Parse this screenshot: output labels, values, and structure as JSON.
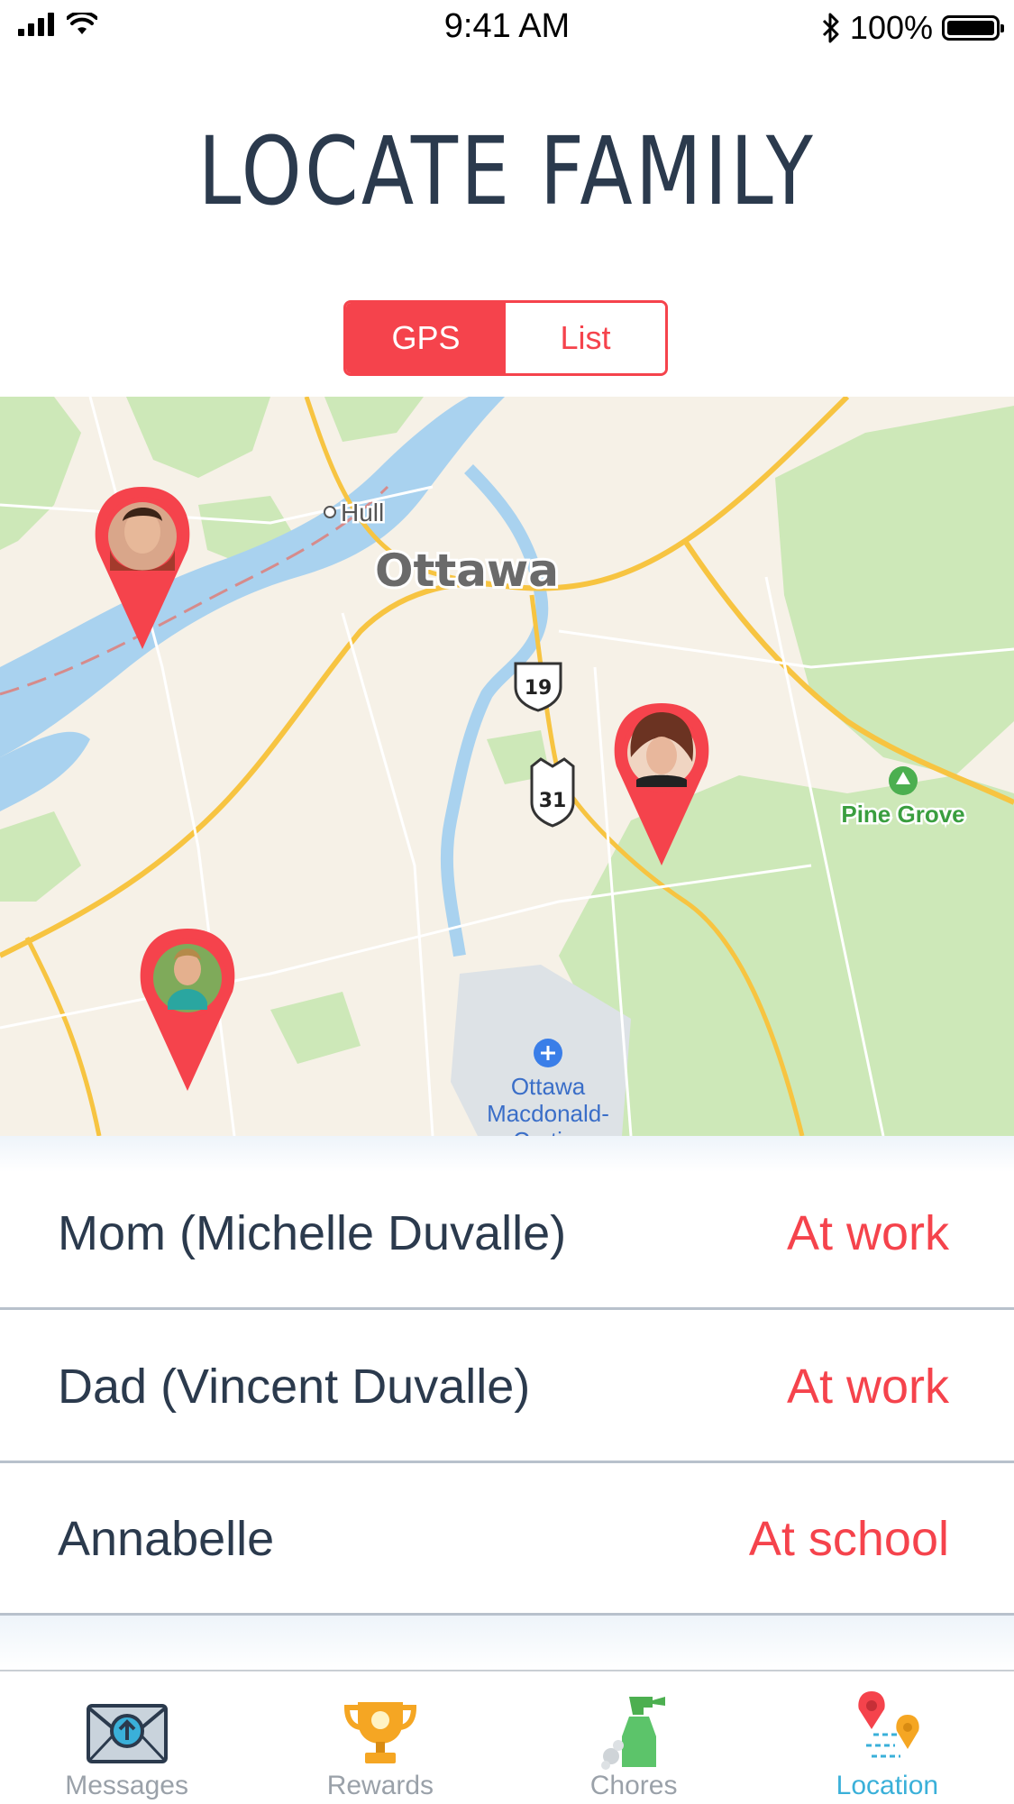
{
  "status_bar": {
    "time": "9:41 AM",
    "battery_percent": "100%",
    "icons": [
      "signal-icon",
      "wifi-icon",
      "bluetooth-icon",
      "battery-icon"
    ]
  },
  "header": {
    "title": "LOCATE FAMILY"
  },
  "view_toggle": {
    "options": [
      "GPS",
      "List"
    ],
    "selected": "GPS"
  },
  "map": {
    "labels": {
      "city": "Ottawa",
      "hull": "Hull",
      "highway_19": "19",
      "highway_31": "31",
      "park": "Pine Grove",
      "airport_line1": "Ottawa",
      "airport_line2": "Macdonald-",
      "airport_line3": "Cartier"
    }
  },
  "family": [
    {
      "name": "Mom (Michelle Duvalle)",
      "status": "At work"
    },
    {
      "name": "Dad (Vincent Duvalle)",
      "status": "At work"
    },
    {
      "name": "Annabelle",
      "status": "At school"
    }
  ],
  "tabs": [
    {
      "label": "Messages",
      "icon": "envelope-upload-icon"
    },
    {
      "label": "Rewards",
      "icon": "trophy-icon"
    },
    {
      "label": "Chores",
      "icon": "spray-bottle-icon"
    },
    {
      "label": "Location",
      "icon": "location-pins-icon"
    }
  ],
  "active_tab": "Location",
  "colors": {
    "accent": "#f5434c",
    "title": "#2b3a4d",
    "active_tab": "#3ab0d9",
    "water": "#a9d2ef",
    "park": "#cde8b8",
    "road": "#f7c441"
  }
}
